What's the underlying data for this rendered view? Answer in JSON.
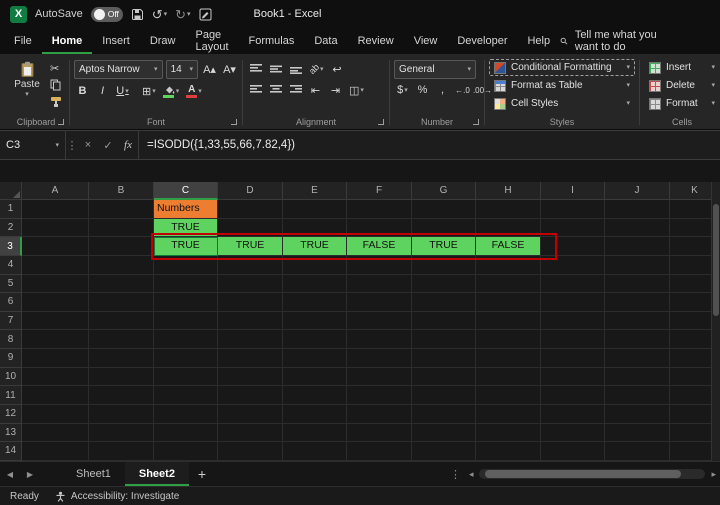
{
  "titlebar": {
    "autosave_label": "AutoSave",
    "autosave_state": "Off",
    "title": "Book1 - Excel"
  },
  "ribbon_tabs": {
    "items": [
      "File",
      "Home",
      "Insert",
      "Draw",
      "Page Layout",
      "Formulas",
      "Data",
      "Review",
      "View",
      "Developer",
      "Help"
    ],
    "active": "Home",
    "search_label": "Tell me what you want to do"
  },
  "ribbon": {
    "clipboard": {
      "group_label": "Clipboard",
      "paste_label": "Paste"
    },
    "font": {
      "group_label": "Font",
      "font_name": "Aptos Narrow",
      "font_size": "14",
      "bold": "B",
      "italic": "I",
      "underline": "U"
    },
    "alignment": {
      "group_label": "Alignment",
      "orientation": "ab"
    },
    "number": {
      "group_label": "Number",
      "format": "General",
      "currency": "$",
      "percent": "%",
      "comma": ",",
      "inc_decimal": "←.0",
      "dec_decimal": ".00→"
    },
    "styles": {
      "group_label": "Styles",
      "items": [
        {
          "label": "Conditional Formatting",
          "icon": "conditional-formatting-icon",
          "highlighted": true
        },
        {
          "label": "Format as Table",
          "icon": "format-as-table-icon",
          "highlighted": false
        },
        {
          "label": "Cell Styles",
          "icon": "cell-styles-icon",
          "highlighted": false
        }
      ]
    },
    "cells": {
      "group_label": "Cells",
      "items": [
        {
          "label": "Insert",
          "icon": "insert-cells-icon"
        },
        {
          "label": "Delete",
          "icon": "delete-cells-icon"
        },
        {
          "label": "Format",
          "icon": "format-cells-icon"
        }
      ]
    }
  },
  "formula_bar": {
    "name_box": "C3",
    "fx_label": "fx",
    "formula": "=ISODD({1,33,55,66,7.82,4})"
  },
  "grid": {
    "col_headers": [
      "A",
      "B",
      "C",
      "D",
      "E",
      "F",
      "G",
      "H",
      "I",
      "J",
      "K"
    ],
    "row_count": 14,
    "selected_col": "C",
    "selected_row": 3,
    "cells": [
      {
        "ref": "C1",
        "col": "C",
        "row": 1,
        "text": "Numbers",
        "bg": "#ED7D31",
        "align": "left"
      },
      {
        "ref": "C2",
        "col": "C",
        "row": 2,
        "text": "TRUE",
        "bg": "#5FD35F",
        "align": "center"
      },
      {
        "ref": "C3",
        "col": "C",
        "row": 3,
        "text": "TRUE",
        "bg": "#5FD35F",
        "align": "center"
      },
      {
        "ref": "D3",
        "col": "D",
        "row": 3,
        "text": "TRUE",
        "bg": "#5FD35F",
        "align": "center"
      },
      {
        "ref": "E3",
        "col": "E",
        "row": 3,
        "text": "TRUE",
        "bg": "#5FD35F",
        "align": "center"
      },
      {
        "ref": "F3",
        "col": "F",
        "row": 3,
        "text": "FALSE",
        "bg": "#5FD35F",
        "align": "center"
      },
      {
        "ref": "G3",
        "col": "G",
        "row": 3,
        "text": "TRUE",
        "bg": "#5FD35F",
        "align": "center"
      },
      {
        "ref": "H3",
        "col": "H",
        "row": 3,
        "text": "FALSE",
        "bg": "#5FD35F",
        "align": "center"
      }
    ],
    "highlight_range": {
      "from": "C3",
      "to": "H3",
      "border_color": "#C00000"
    }
  },
  "sheet_bar": {
    "tabs": [
      {
        "label": "Sheet1",
        "active": false
      },
      {
        "label": "Sheet2",
        "active": true
      }
    ],
    "add_label": "+"
  },
  "status_bar": {
    "mode": "Ready",
    "accessibility": "Accessibility: Investigate"
  },
  "colors": {
    "accent_green": "#2f9e44",
    "fill_green": "#5FD35F",
    "fill_orange": "#ED7D31",
    "highlight_red": "#C00000",
    "font_color_red": "#E03E3E"
  },
  "icons": {
    "chevron-down": "▾",
    "scissors": "✂",
    "undo": "↺",
    "redo": "↻",
    "close": "×",
    "check": "✓",
    "dots-vertical": "⋮",
    "borders": "⊞",
    "merge": "◫",
    "wrap": "↩",
    "indent-left": "⇤",
    "indent-right": "⇥",
    "sigma": "Σ",
    "nav-left": "◀",
    "nav-right": "▶",
    "scroll-left": "◂",
    "scroll-right": "▸",
    "grow-font": "A▴",
    "shrink-font": "A▾"
  }
}
